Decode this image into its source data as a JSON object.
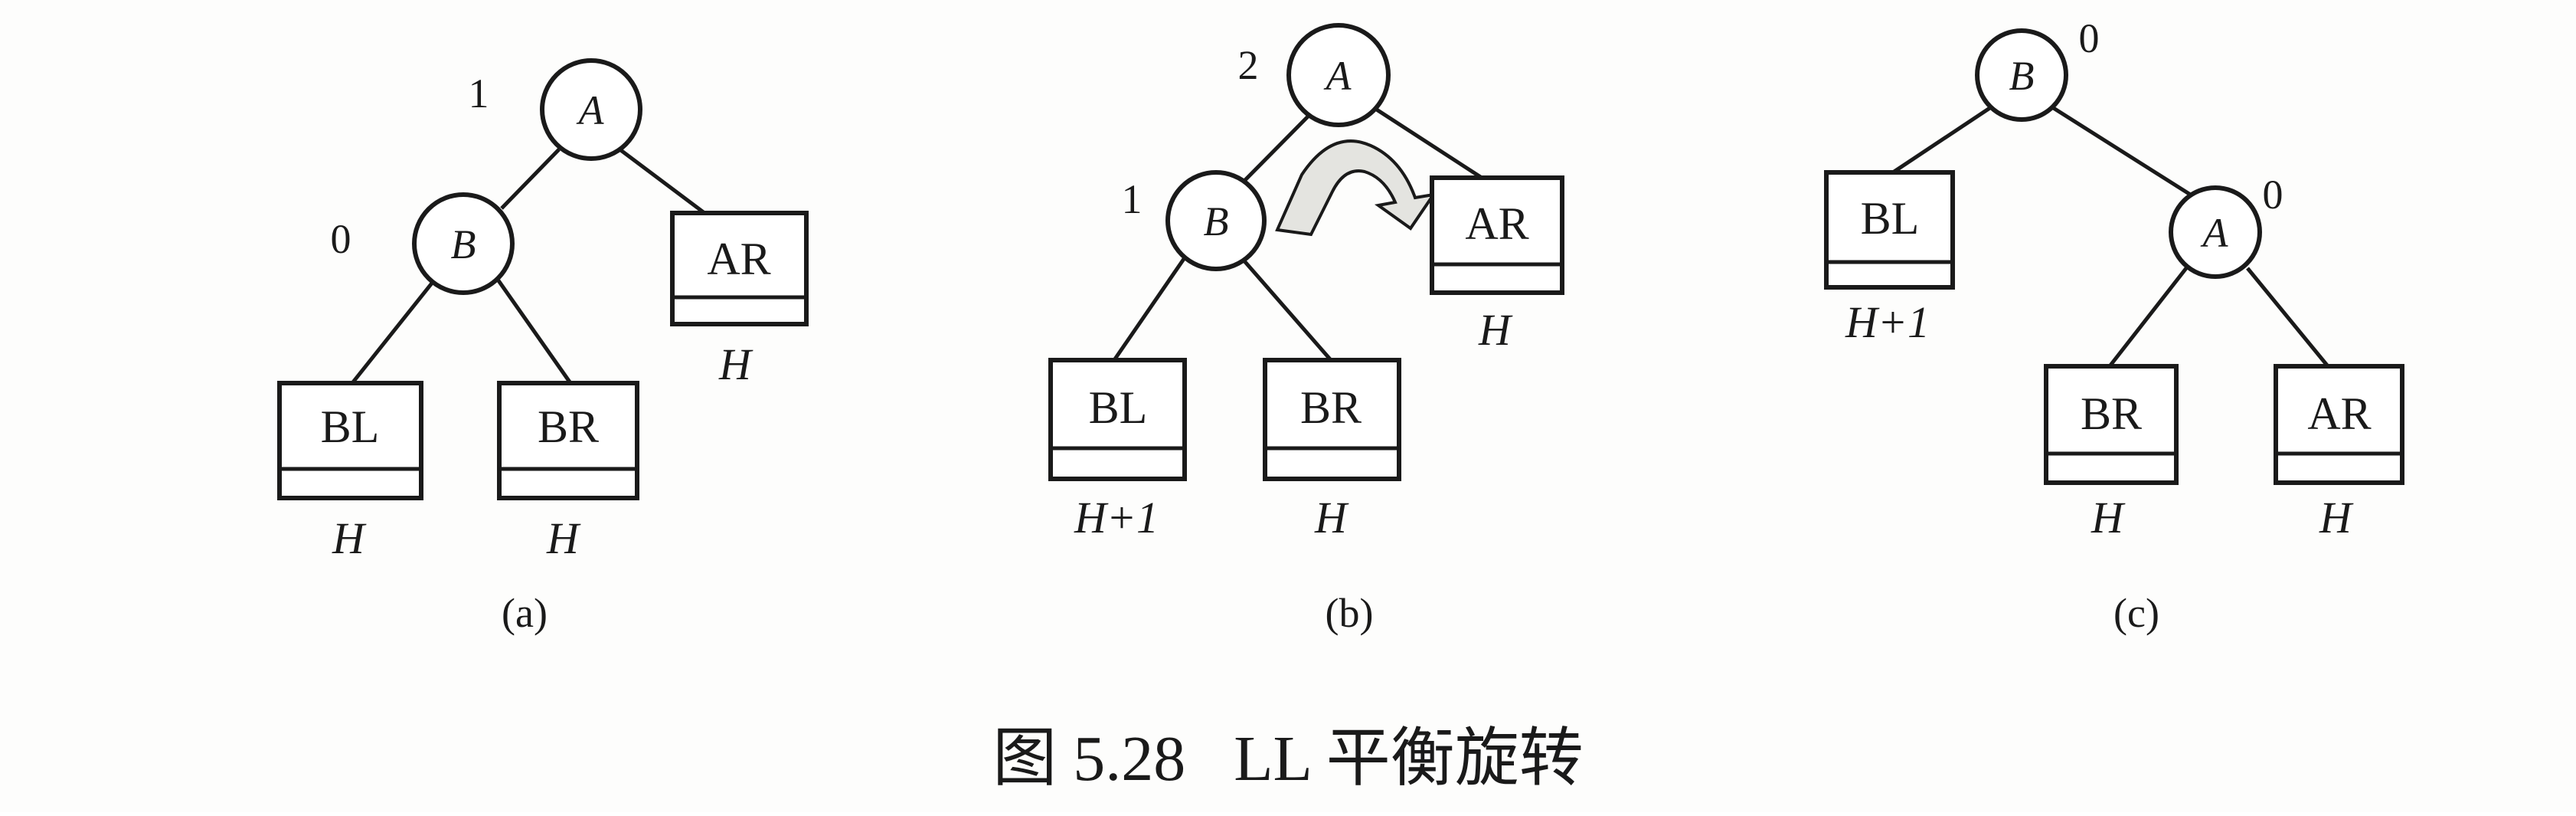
{
  "caption": "图 5.28   LL 平衡旋转",
  "panels": {
    "a": {
      "label": "(a)",
      "nodes": {
        "A": "A",
        "B": "B"
      },
      "balance": {
        "A": "1",
        "B": "0"
      },
      "subtrees": {
        "BL": {
          "name": "BL",
          "height": "H"
        },
        "BR": {
          "name": "BR",
          "height": "H"
        },
        "AR": {
          "name": "AR",
          "height": "H"
        }
      }
    },
    "b": {
      "label": "(b)",
      "nodes": {
        "A": "A",
        "B": "B"
      },
      "balance": {
        "A": "2",
        "B": "1"
      },
      "subtrees": {
        "BL": {
          "name": "BL",
          "height": "H+1"
        },
        "BR": {
          "name": "BR",
          "height": "H"
        },
        "AR": {
          "name": "AR",
          "height": "H"
        }
      }
    },
    "c": {
      "label": "(c)",
      "nodes": {
        "A": "A",
        "B": "B"
      },
      "balance": {
        "A": "0",
        "B": "0"
      },
      "subtrees": {
        "BL": {
          "name": "BL",
          "height": "H+1"
        },
        "BR": {
          "name": "BR",
          "height": "H"
        },
        "AR": {
          "name": "AR",
          "height": "H"
        }
      }
    }
  }
}
